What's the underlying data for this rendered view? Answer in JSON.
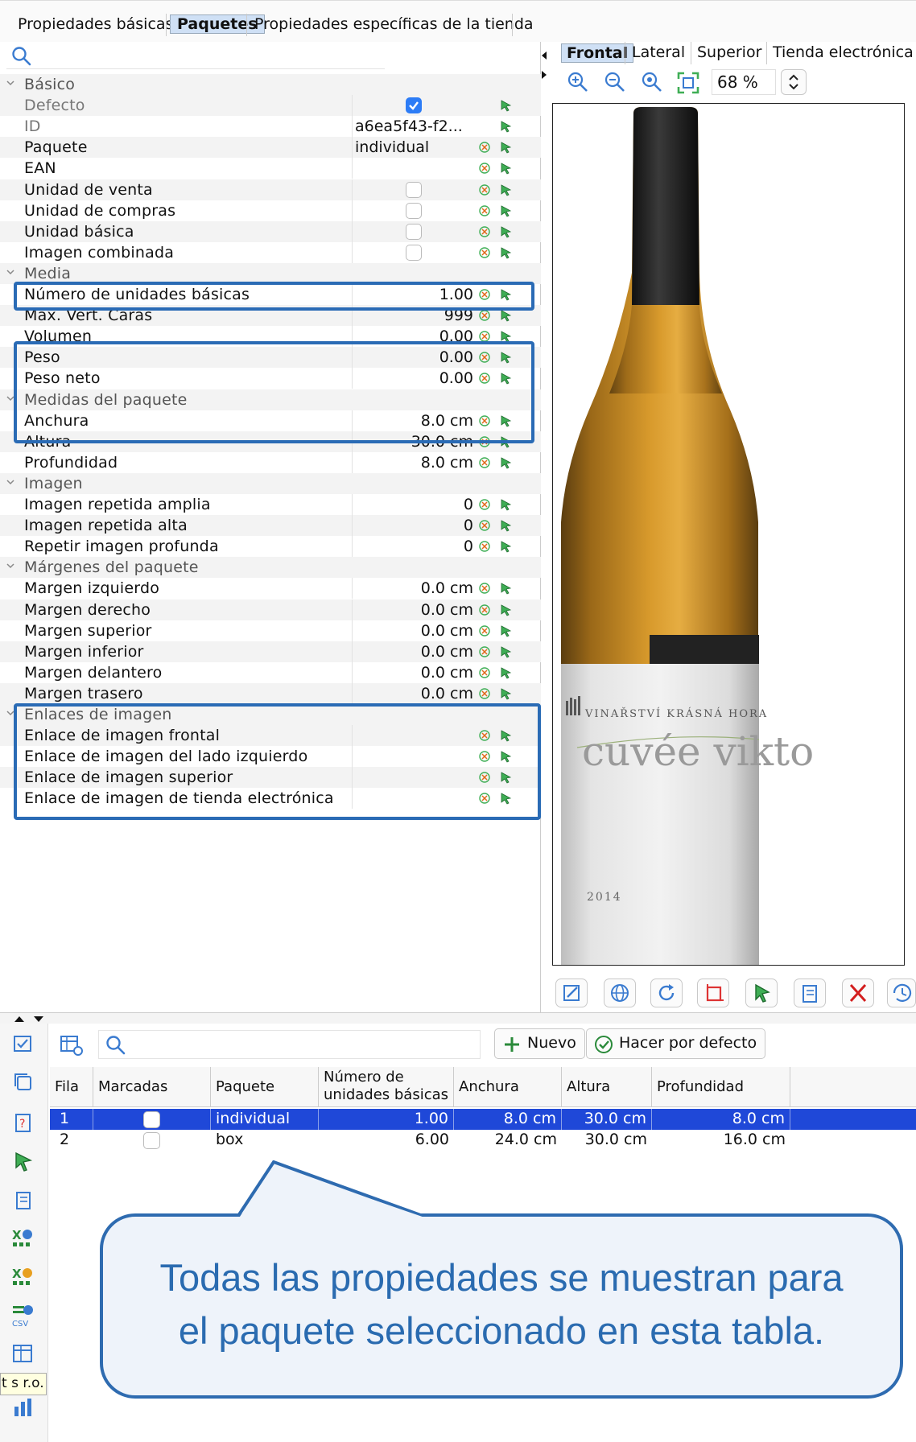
{
  "tabs": {
    "basic": "Propiedades básicas",
    "packages": "Paquetes",
    "store": "Propiedades específicas de la tienda"
  },
  "properties": [
    {
      "name": "Básico",
      "value": "",
      "kind": "group"
    },
    {
      "name": "Defecto",
      "value": "",
      "kind": "check-on",
      "dim": true
    },
    {
      "name": "ID",
      "value": "a6ea5f43-f2...",
      "kind": "text-left",
      "dim": true
    },
    {
      "name": "Paquete",
      "value": "individual",
      "kind": "text-left"
    },
    {
      "name": "EAN",
      "value": "",
      "kind": "text"
    },
    {
      "name": "Unidad de venta",
      "value": "",
      "kind": "check"
    },
    {
      "name": "Unidad de compras",
      "value": "",
      "kind": "check"
    },
    {
      "name": "Unidad básica",
      "value": "",
      "kind": "check"
    },
    {
      "name": "Imagen combinada",
      "value": "",
      "kind": "check"
    },
    {
      "name": "Media",
      "value": "",
      "kind": "group"
    },
    {
      "name": "Número de unidades básicas",
      "value": "1.00",
      "kind": "text"
    },
    {
      "name": "Max. Vert. Caras",
      "value": "999",
      "kind": "text"
    },
    {
      "name": "Volumen",
      "value": "0.00",
      "kind": "text"
    },
    {
      "name": "Peso",
      "value": "0.00",
      "kind": "text"
    },
    {
      "name": "Peso neto",
      "value": "0.00",
      "kind": "text"
    },
    {
      "name": "Medidas del paquete",
      "value": "",
      "kind": "group"
    },
    {
      "name": "Anchura",
      "value": "8.0 cm",
      "kind": "text"
    },
    {
      "name": "Altura",
      "value": "30.0 cm",
      "kind": "text"
    },
    {
      "name": "Profundidad",
      "value": "8.0 cm",
      "kind": "text"
    },
    {
      "name": "Imagen",
      "value": "",
      "kind": "group"
    },
    {
      "name": "Imagen repetida amplia",
      "value": "0",
      "kind": "text"
    },
    {
      "name": "Imagen repetida alta",
      "value": "0",
      "kind": "text"
    },
    {
      "name": "Repetir imagen profunda",
      "value": "0",
      "kind": "text"
    },
    {
      "name": "Márgenes del paquete",
      "value": "",
      "kind": "group"
    },
    {
      "name": "Margen izquierdo",
      "value": "0.0 cm",
      "kind": "text"
    },
    {
      "name": "Margen derecho",
      "value": "0.0 cm",
      "kind": "text"
    },
    {
      "name": "Margen superior",
      "value": "0.0 cm",
      "kind": "text"
    },
    {
      "name": "Margen inferior",
      "value": "0.0 cm",
      "kind": "text"
    },
    {
      "name": "Margen delantero",
      "value": "0.0 cm",
      "kind": "text"
    },
    {
      "name": "Margen trasero",
      "value": "0.0 cm",
      "kind": "text"
    },
    {
      "name": "Enlaces de imagen",
      "value": "",
      "kind": "group"
    },
    {
      "name": "Enlace de imagen frontal",
      "value": "",
      "kind": "text"
    },
    {
      "name": "Enlace de imagen del lado izquierdo",
      "value": "",
      "kind": "text"
    },
    {
      "name": "Enlace de imagen superior",
      "value": "",
      "kind": "text"
    },
    {
      "name": "Enlace de imagen de tienda electrónica",
      "value": "",
      "kind": "text"
    }
  ],
  "image_tabs": {
    "front": "Frontal",
    "side": "Lateral",
    "top": "Superior",
    "estore": "Tienda electrónica"
  },
  "zoom": "68 %",
  "label": {
    "winery": "VINAŘSTVÍ KRÁSNÁ HORA",
    "wine": "cuvée vikto",
    "year": "2014"
  },
  "table": {
    "new_button": "Nuevo",
    "default_button": "Hacer por defecto",
    "headers": {
      "row": "Fila",
      "marked": "Marcadas",
      "package": "Paquete",
      "units_1": "Número de",
      "units_2": "unidades básicas",
      "width": "Anchura",
      "height": "Altura",
      "depth": "Profundidad"
    },
    "rows": [
      {
        "row": "1",
        "package": "individual",
        "units": "1.00",
        "width": "8.0 cm",
        "height": "30.0 cm",
        "depth": "8.0 cm"
      },
      {
        "row": "2",
        "package": "box",
        "units": "6.00",
        "width": "24.0 cm",
        "height": "30.0 cm",
        "depth": "16.0 cm"
      }
    ]
  },
  "tooltip": "t s r.o.",
  "callout": {
    "line1": "Todas las propiedades se muestran para",
    "line2": "el paquete seleccionado en esta tabla."
  },
  "colors": {
    "accent": "#2a6bb0",
    "selection": "#1f48d8",
    "tab_selected": "#cfe0f5"
  }
}
